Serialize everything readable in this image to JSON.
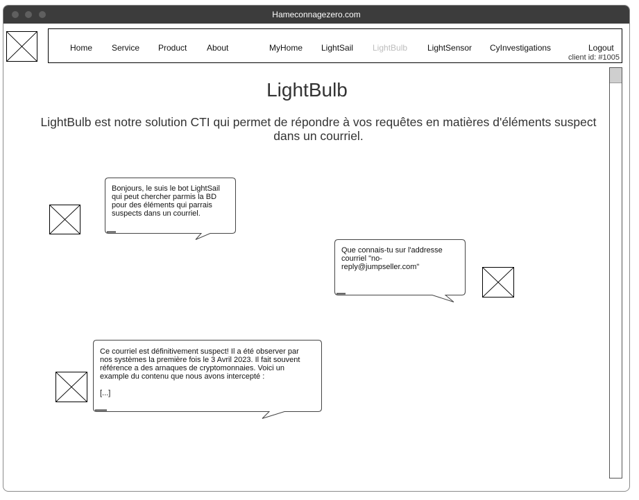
{
  "window": {
    "title": "Hameconnagezero.com"
  },
  "nav": {
    "items": [
      {
        "label": "Home",
        "active": false
      },
      {
        "label": "Service",
        "active": false
      },
      {
        "label": "Product",
        "active": false
      },
      {
        "label": "About",
        "active": false
      },
      {
        "label": "MyHome",
        "active": false
      },
      {
        "label": "LightSail",
        "active": false
      },
      {
        "label": "LightBulb",
        "active": true
      },
      {
        "label": "LightSensor",
        "active": false
      },
      {
        "label": "CyInvestigations",
        "active": false
      },
      {
        "label": "Logout",
        "active": false
      }
    ],
    "client_id": "client id: #1005"
  },
  "page": {
    "title": "LightBulb",
    "subtitle": "LightBulb est notre solution CTI qui permet de répondre à vos requêtes en matières d'éléments suspect dans un courriel."
  },
  "chat": [
    {
      "sender": "bot",
      "text": "Bonjours, le suis le bot LightSail qui peut chercher parmis la BD pour des éléments qui parrais suspects dans un courriel."
    },
    {
      "sender": "user",
      "text": "Que connais-tu sur l'addresse courriel \"no-reply@jumpseller.com\""
    },
    {
      "sender": "bot",
      "text": "Ce courriel est définitivement suspect! Il a été observer par nos systèmes la première fois le 3 Avril 2023. Il fait souvent référence a des arnaques de cryptomonnaies. Voici un example du contenu que nous avons intercepté :",
      "extra": "[...]"
    }
  ]
}
